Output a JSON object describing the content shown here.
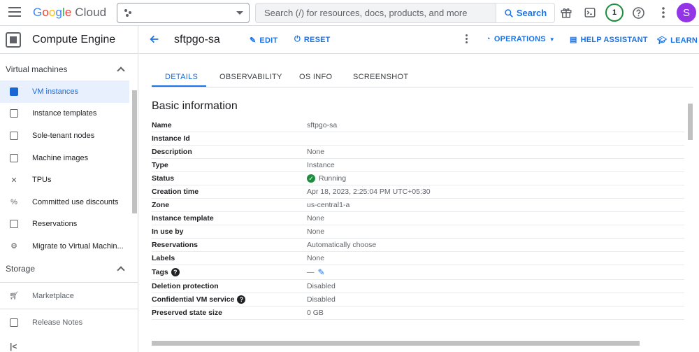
{
  "topbar": {
    "logo": {
      "letters": [
        "G",
        "o",
        "o",
        "g",
        "l",
        "e"
      ],
      "cloud": "Cloud"
    },
    "search_placeholder": "Search (/) for resources, docs, products, and more",
    "search_button": "Search",
    "notification_count": "1",
    "avatar_initial": "S",
    "icons": [
      "menu-icon",
      "gift-icon",
      "terminal-icon",
      "help-icon",
      "more-vert-icon"
    ]
  },
  "sidebar": {
    "product": "Compute Engine",
    "sections": [
      {
        "label": "Virtual machines",
        "items": [
          {
            "label": "VM instances",
            "icon": "vm-icon"
          },
          {
            "label": "Instance templates",
            "icon": "template-icon"
          },
          {
            "label": "Sole-tenant nodes",
            "icon": "node-icon"
          },
          {
            "label": "Machine images",
            "icon": "image-icon"
          },
          {
            "label": "TPUs",
            "icon": "tpu-icon"
          },
          {
            "label": "Committed use discounts",
            "icon": "percent-icon"
          },
          {
            "label": "Reservations",
            "icon": "calendar-icon"
          },
          {
            "label": "Migrate to Virtual Machin...",
            "icon": "migrate-icon"
          }
        ]
      },
      {
        "label": "Storage",
        "items": []
      }
    ],
    "footer_items": [
      {
        "label": "Marketplace",
        "icon": "cart-icon"
      },
      {
        "label": "Release Notes",
        "icon": "notes-icon"
      }
    ]
  },
  "header": {
    "vm_name": "sftpgo-sa",
    "edit": "EDIT",
    "reset": "RESET",
    "operations": "OPERATIONS",
    "help_assistant": "HELP ASSISTANT",
    "learn": "LEARN"
  },
  "tabs": [
    "DETAILS",
    "OBSERVABILITY",
    "OS INFO",
    "SCREENSHOT"
  ],
  "basic_info": {
    "title": "Basic information",
    "rows": [
      {
        "key": "Name",
        "value": "sftpgo-sa"
      },
      {
        "key": "Instance Id",
        "value": ""
      },
      {
        "key": "Description",
        "value": "None"
      },
      {
        "key": "Type",
        "value": "Instance"
      },
      {
        "key": "Status",
        "value": "Running"
      },
      {
        "key": "Creation time",
        "value": "Apr 18, 2023, 2:25:04 PM UTC+05:30"
      },
      {
        "key": "Zone",
        "value": "us-central1-a"
      },
      {
        "key": "Instance template",
        "value": "None"
      },
      {
        "key": "In use by",
        "value": "None"
      },
      {
        "key": "Reservations",
        "value": "Automatically choose"
      },
      {
        "key": "Labels",
        "value": "None"
      },
      {
        "key": "Tags",
        "value": "—"
      },
      {
        "key": "Deletion protection",
        "value": "Disabled"
      },
      {
        "key": "Confidential VM service",
        "value": "Disabled"
      },
      {
        "key": "Preserved state size",
        "value": "0 GB"
      }
    ]
  }
}
